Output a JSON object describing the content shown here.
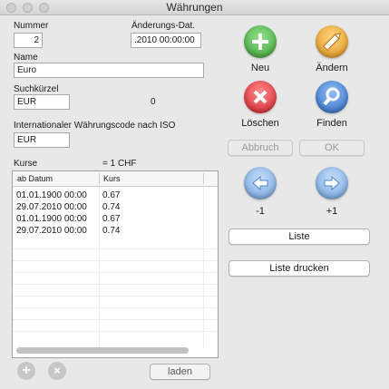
{
  "window": {
    "title": "Währungen"
  },
  "form": {
    "nummer_label": "Nummer",
    "nummer_value": "2",
    "aenderung_label": "Änderungs-Dat.",
    "aenderung_value": ".2010  00:00:00",
    "name_label": "Name",
    "name_value": "Euro",
    "suchkuerzel_label": "Suchkürzel",
    "suchkuerzel_value": "EUR",
    "suchkuerzel_count": "0",
    "iso_label": "Internationaler Währungscode nach ISO",
    "iso_value": "EUR",
    "kurse_label": "Kurse",
    "kurse_unit": "= 1 CHF"
  },
  "table": {
    "columns": [
      "ab Datum",
      "Kurs"
    ],
    "rows": [
      {
        "datum": "01.01.1900  00:00",
        "kurs": "0.67"
      },
      {
        "datum": "29.07.2010  00:00",
        "kurs": "0.74"
      },
      {
        "datum": "01.01.1900  00:00",
        "kurs": "0.67"
      },
      {
        "datum": "29.07.2010  00:00",
        "kurs": "0.74"
      }
    ]
  },
  "actions": {
    "neu": "Neu",
    "aendern": "Ändern",
    "loeschen": "Löschen",
    "finden": "Finden",
    "abbruch": "Abbruch",
    "ok": "OK",
    "prev": "-1",
    "next": "+1",
    "liste": "Liste",
    "liste_drucken": "Liste drucken",
    "laden": "laden"
  },
  "icons": {
    "neu": "plus-icon",
    "aendern": "pencil-icon",
    "loeschen": "x-icon",
    "finden": "magnifier-icon",
    "prev": "arrow-left-icon",
    "next": "arrow-right-icon",
    "add_row": "plus-icon",
    "remove_row": "x-icon"
  },
  "colors": {
    "green": "#4bb543",
    "orange": "#f0a830",
    "red": "#e0303a",
    "blue": "#3d7fd6",
    "light_blue": "#7aaee8"
  }
}
